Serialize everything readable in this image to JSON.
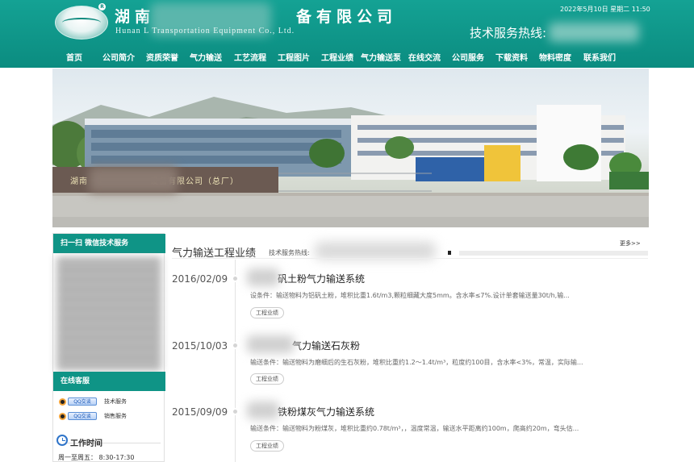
{
  "header": {
    "company_cn": "湖南　　　　　　　备有限公司",
    "company_en": "Hunan L           Transportation Equipment Co., Ltd.",
    "datetime": "2022年5月10日 星期二 11:50",
    "hotline_label": "技术服务热线:"
  },
  "nav": {
    "items": [
      {
        "label": "首页"
      },
      {
        "label": "公司简介"
      },
      {
        "label": "资质荣誉"
      },
      {
        "label": "气力输送"
      },
      {
        "label": "工艺流程"
      },
      {
        "label": "工程图片"
      },
      {
        "label": "工程业绩"
      },
      {
        "label": "气力输送泵"
      },
      {
        "label": "在线交流"
      },
      {
        "label": "公司服务"
      },
      {
        "label": "下载资料"
      },
      {
        "label": "物料密度"
      },
      {
        "label": "联系我们"
      }
    ]
  },
  "banner": {
    "sign_text": "湖南　　　　　　　设备有限公司（总厂）"
  },
  "sidebar": {
    "qr_title": "扫一扫 微信技术服务",
    "online_title": "在线客服",
    "qq_badge": "QQ交谈",
    "services": [
      "技术服务",
      "销售服务"
    ],
    "worktime_title": "工作时间",
    "worktime": "周一至周五： 8:30-17:30"
  },
  "main": {
    "title": "气力输送工程业绩",
    "hotline_label": "技术服务热线:",
    "more": "更多>>",
    "entries": [
      {
        "date": "2016/02/09",
        "title": "矾土粉气力输送系统",
        "desc": "设条件：输送物料为铝矾土粉，堆积比重1.6t/m3,颗粒细藏大度5mm。含水率≤7%.设计单套输送量30t/h,输...",
        "tag": "工程业绩"
      },
      {
        "date": "2015/10/03",
        "title": "气力输送石灰粉",
        "desc": "输送条件：输送物料为磨细后的生石灰粉，堆积比重约1.2～1.4t/m³，粒度约100目，含水率<3%，常温，实际输...",
        "tag": "工程业绩"
      },
      {
        "date": "2015/09/09",
        "title": "铁粉煤灰气力输送系统",
        "desc": "输送条件：输送物料为粉煤灰，堆积比重约0.78t/m³，，温度常温，输送水平距离约100m，爬高约20m，弯头估...",
        "tag": "工程业绩"
      }
    ]
  }
}
